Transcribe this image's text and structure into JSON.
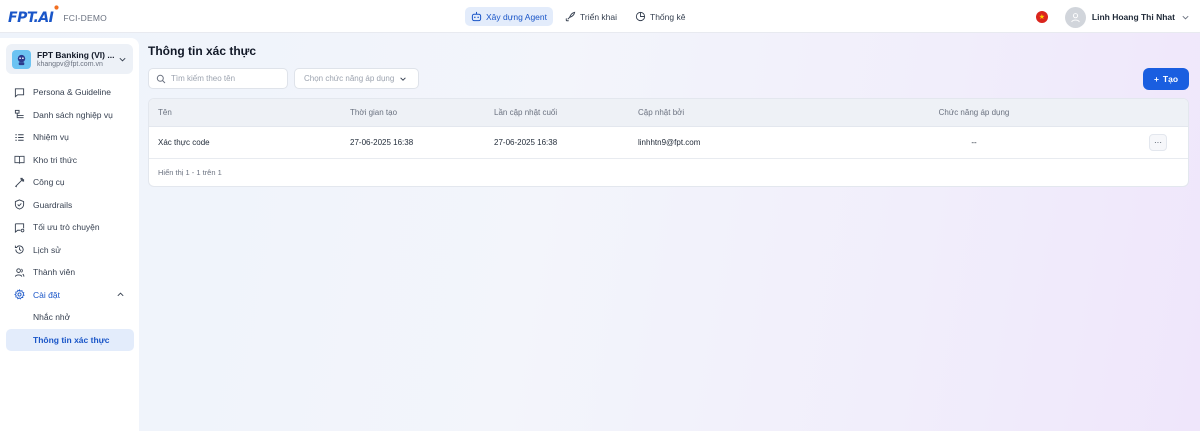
{
  "brand": {
    "logo_text": "FPT.AI",
    "org_label": "FCI-DEMO"
  },
  "topnav": {
    "items": [
      {
        "label": "Xây dựng Agent",
        "icon": "bot-icon",
        "active": true
      },
      {
        "label": "Triển khai",
        "icon": "rocket-icon",
        "active": false
      },
      {
        "label": "Thống kê",
        "icon": "pie-chart-icon",
        "active": false
      }
    ]
  },
  "user": {
    "name": "Linh Hoang Thi Nhat",
    "flag": "vietnam-flag"
  },
  "workspace": {
    "name": "FPT Banking (VI) ...",
    "email": "khangpv@fpt.com.vn"
  },
  "sidebar": {
    "items": [
      {
        "label": "Persona & Guideline",
        "icon": "chat-icon"
      },
      {
        "label": "Danh sách nghiệp vụ",
        "icon": "list-tree-icon"
      },
      {
        "label": "Nhiệm vụ",
        "icon": "task-list-icon"
      },
      {
        "label": "Kho tri thức",
        "icon": "book-icon"
      },
      {
        "label": "Công cụ",
        "icon": "wrench-icon"
      },
      {
        "label": "Guardrails",
        "icon": "shield-icon"
      },
      {
        "label": "Tối ưu trò chuyện",
        "icon": "chat-optimize-icon"
      },
      {
        "label": "Lịch sử",
        "icon": "history-icon"
      },
      {
        "label": "Thành viên",
        "icon": "users-icon"
      }
    ],
    "settings": {
      "label": "Cài đặt",
      "children": [
        {
          "label": "Nhắc nhở",
          "active": false
        },
        {
          "label": "Thông tin xác thực",
          "active": true
        }
      ]
    }
  },
  "main": {
    "title": "Thông tin xác thực",
    "search_placeholder": "Tìm kiếm theo tên",
    "filter_placeholder": "Chọn chức năng áp dụng",
    "create_label": "Tạo",
    "table": {
      "columns": [
        "Tên",
        "Thời gian tạo",
        "Lần cập nhật cuối",
        "Cập nhật bởi",
        "Chức năng áp dụng"
      ],
      "rows": [
        [
          "Xác thực code",
          "27-06-2025 16:38",
          "27-06-2025 16:38",
          "linhhtn9@fpt.com",
          "--"
        ]
      ],
      "more_label": "···",
      "footer": "Hiển thị 1 - 1 trên 1"
    }
  },
  "colors": {
    "accent": "#1a5ee0",
    "active_bg": "#e3ecfb",
    "flag_red": "#da251d"
  }
}
